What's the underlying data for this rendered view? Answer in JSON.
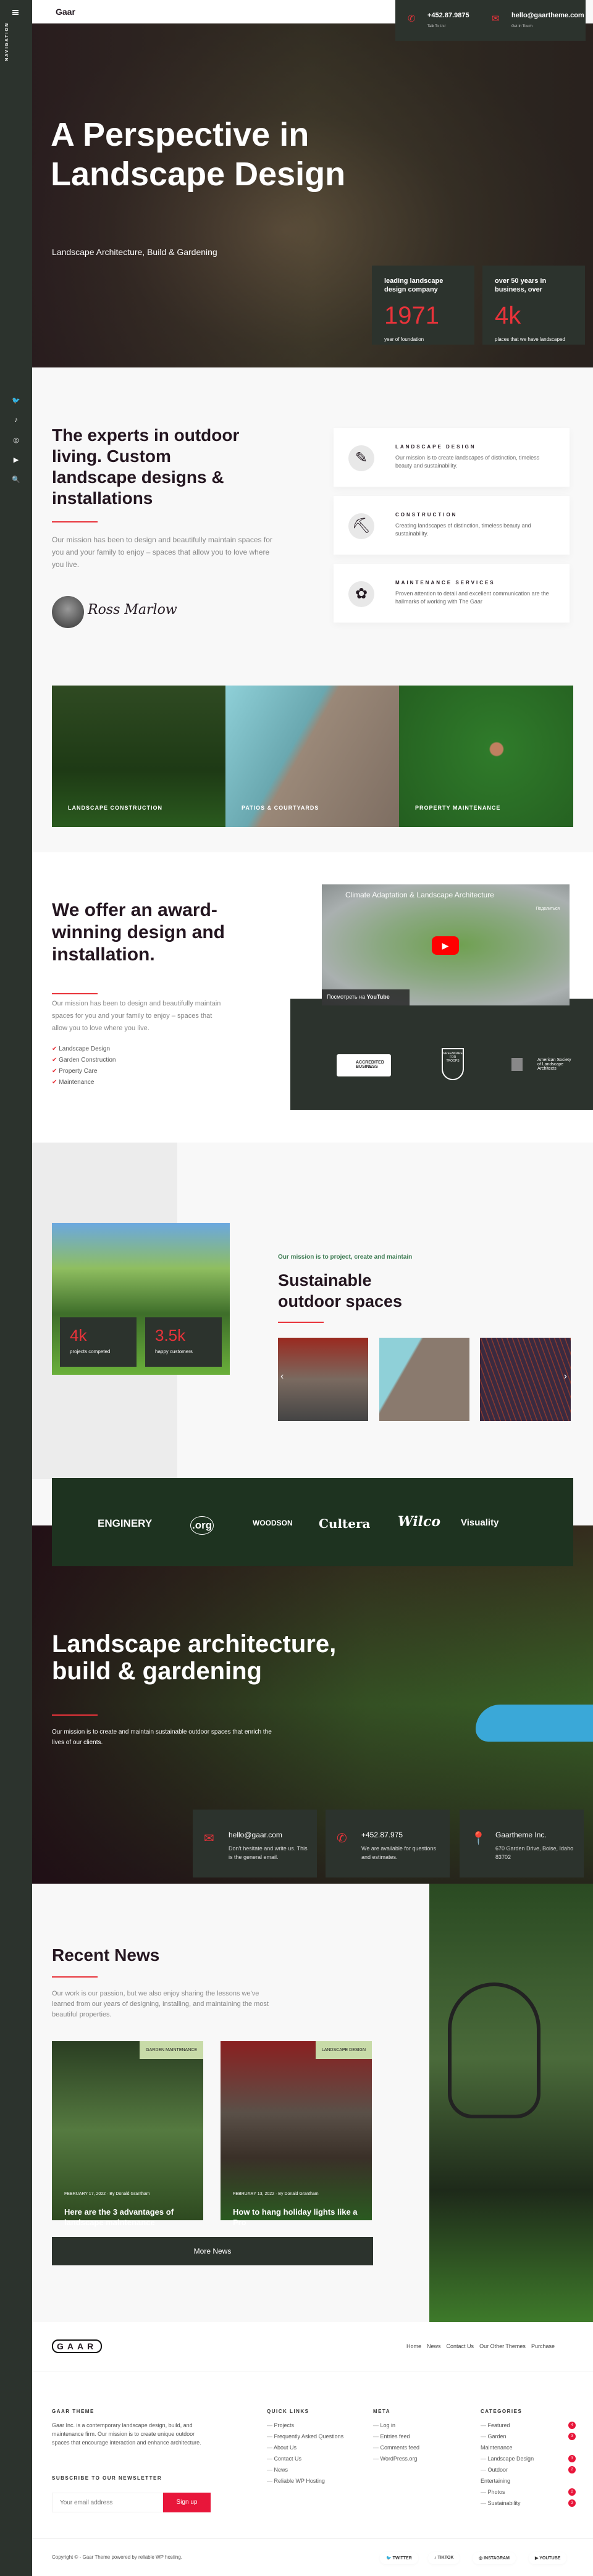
{
  "sidebar": {
    "nav_label": "NAVIGATION",
    "socials": [
      "twitter-icon",
      "tiktok-icon",
      "instagram-icon",
      "youtube-icon",
      "search-icon"
    ]
  },
  "header": {
    "logo": "Gaar",
    "phone": "+452.87.9875",
    "phone_sub": "Talk To Us!",
    "email": "hello@gaartheme.com",
    "email_sub": "Get In Touch"
  },
  "hero": {
    "title": "A Perspective in Landscape Design",
    "subtitle": "Landscape Architecture, Build & Gardening",
    "stats": [
      {
        "label": "leading landscape design company",
        "value": "1971",
        "caption": "year of foundation"
      },
      {
        "label": "over 50 years in business, over",
        "value": "4k",
        "caption": "places that we have landscaped"
      }
    ]
  },
  "experts": {
    "title": "The experts in outdoor living. Custom landscape designs & installations",
    "text": "Our mission has been to design and beautifully maintain spaces for you and your family to enjoy – spaces that allow you to love where you live.",
    "signature": "Ross Marlow",
    "services": [
      {
        "icon": "ruler-pencil-icon",
        "title": "LANDSCAPE DESIGN",
        "text": "Our mission is to create landscapes of distinction, timeless beauty and sustainability."
      },
      {
        "icon": "wheelbarrow-icon",
        "title": "CONSTRUCTION",
        "text": "Creating landscapes of distinction, timeless beauty and sustainability."
      },
      {
        "icon": "flower-shovel-icon",
        "title": "MAINTENANCE SERVICES",
        "text": "Proven attention to detail and excellent communication are the hallmarks of working with The Gaar"
      }
    ]
  },
  "gallery": [
    "LANDSCAPE CONSTRUCTION",
    "PATIOS & COURTYARDS",
    "PROPERTY MAINTENANCE"
  ],
  "award": {
    "title": "We offer an award-winning design and installation.",
    "text": "Our mission has been to design and beautifully maintain spaces for you and your family to enjoy – spaces that allow you to love where you live.",
    "list": [
      "Landscape Design",
      "Garden Construction",
      "Property Care",
      "Maintenance"
    ],
    "video": {
      "title": "Climate Adaptation & Landscape Architecture",
      "share": "Поделиться",
      "watch": "Посмотреть на",
      "youtube": "YouTube"
    },
    "badges": [
      "ACCREDITED BUSINESS",
      "GREENCARE FOR TROOPS",
      "American Society of Landscape Architects"
    ]
  },
  "mission": {
    "kicker": "Our mission is to project, create and maintain",
    "title": "Sustainable outdoor spaces",
    "stats": [
      {
        "value": "4k",
        "caption": "projects competed"
      },
      {
        "value": "3.5k",
        "caption": "happy customers"
      }
    ]
  },
  "partners": [
    "ENGINERY",
    ".org",
    "WOODSON",
    "Cultera",
    "Wilco",
    "Visuality"
  ],
  "architecture": {
    "title": "Landscape architecture, build & gardening",
    "text": "Our mission is to create and maintain sustainable outdoor spaces that enrich the lives of our clients.",
    "contacts": [
      {
        "icon": "mail-icon",
        "title": "hello@gaar.com",
        "text": "Don't hesitate and write us. This is the general email."
      },
      {
        "icon": "phone-icon",
        "title": "+452.87.975",
        "text": "We are available for questions and estimates."
      },
      {
        "icon": "location-pin-icon",
        "title": "Gaartheme Inc.",
        "text": "670 Garden Drive, Boise, Idaho 83702"
      }
    ]
  },
  "news": {
    "title": "Recent News",
    "text": "Our work is our passion, but we also enjoy sharing the lessons we've learned from our years of designing, installing, and maintaining the most beautiful properties.",
    "posts": [
      {
        "tag": "GARDEN MAINTENANCE",
        "meta": "FEBRUARY 17, 2022 · By Donald Grantham",
        "title": "Here are the 3 advantages of landscape maintenance"
      },
      {
        "tag": "LANDSCAPE DESIGN",
        "meta": "FEBRUARY 13, 2022 · By Donald Grantham",
        "title": "How to hang holiday lights like a Pro"
      }
    ],
    "more": "More News"
  },
  "footer": {
    "logo": "GAAR",
    "nav": [
      "Home",
      "News",
      "Contact Us",
      "Our Other Themes",
      "Purchase"
    ],
    "about_title": "GAAR THEME",
    "about": "Gaar Inc. is a contemporary landscape design, build, and maintenance firm. Our mission is to create unique outdoor spaces that encourage interaction and enhance architecture.",
    "newsletter_title": "SUBSCRIBE TO OUR NEWSLETTER",
    "email_placeholder": "Your email address",
    "signup": "Sign up",
    "quick_title": "QUICK LINKS",
    "quick": [
      "Projects",
      "Frequently Asked Questions",
      "About Us",
      "Contact Us",
      "News",
      "Reliable WP Hosting"
    ],
    "meta_title": "META",
    "meta": [
      "Log in",
      "Entries feed",
      "Comments feed",
      "WordPress.org"
    ],
    "cat_title": "CATEGORIES",
    "categories": [
      {
        "name": "Featured",
        "count": "4"
      },
      {
        "name": "Garden Maintenance",
        "count": "3"
      },
      {
        "name": "Landscape Design",
        "count": "3"
      },
      {
        "name": "Outdoor Entertaining",
        "count": "2"
      },
      {
        "name": "Photos",
        "count": "2"
      },
      {
        "name": "Sustainability",
        "count": "3"
      }
    ],
    "copyright": "Copyright © - Gaar Theme powered by reliable WP hosting.",
    "socials": [
      "TWITTER",
      "TIKTOK",
      "INSTAGRAM",
      "YOUTUBE"
    ]
  },
  "colors": {
    "accent": "#e8333a",
    "dark": "#2c332d",
    "partner_band": "#1e3320",
    "tag": "#c8dba8"
  }
}
